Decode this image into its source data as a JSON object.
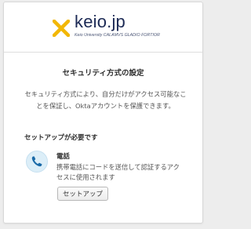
{
  "brand": {
    "name": "keio.jp",
    "tagline": "Keio University CALAMVS GLADIO FORTIOR",
    "colors": {
      "mark": "#f2b705",
      "text": "#1c2a55"
    }
  },
  "page": {
    "title": "セキュリティ方式の設定",
    "description": "セキュリティ方式により、自分だけがアクセス可能なことを保証し、Oktaアカウントを保護できます。"
  },
  "setup_required": {
    "heading": "セットアップが必要です",
    "factors": [
      {
        "icon": "phone-icon",
        "title": "電話",
        "description": "携帯電話にコードを送信して認証するアクセスに使用されます",
        "button_label": "セットアップ"
      }
    ]
  },
  "colors": {
    "icon_circle": "#dceef8",
    "icon_phone": "#1a6aa8"
  }
}
